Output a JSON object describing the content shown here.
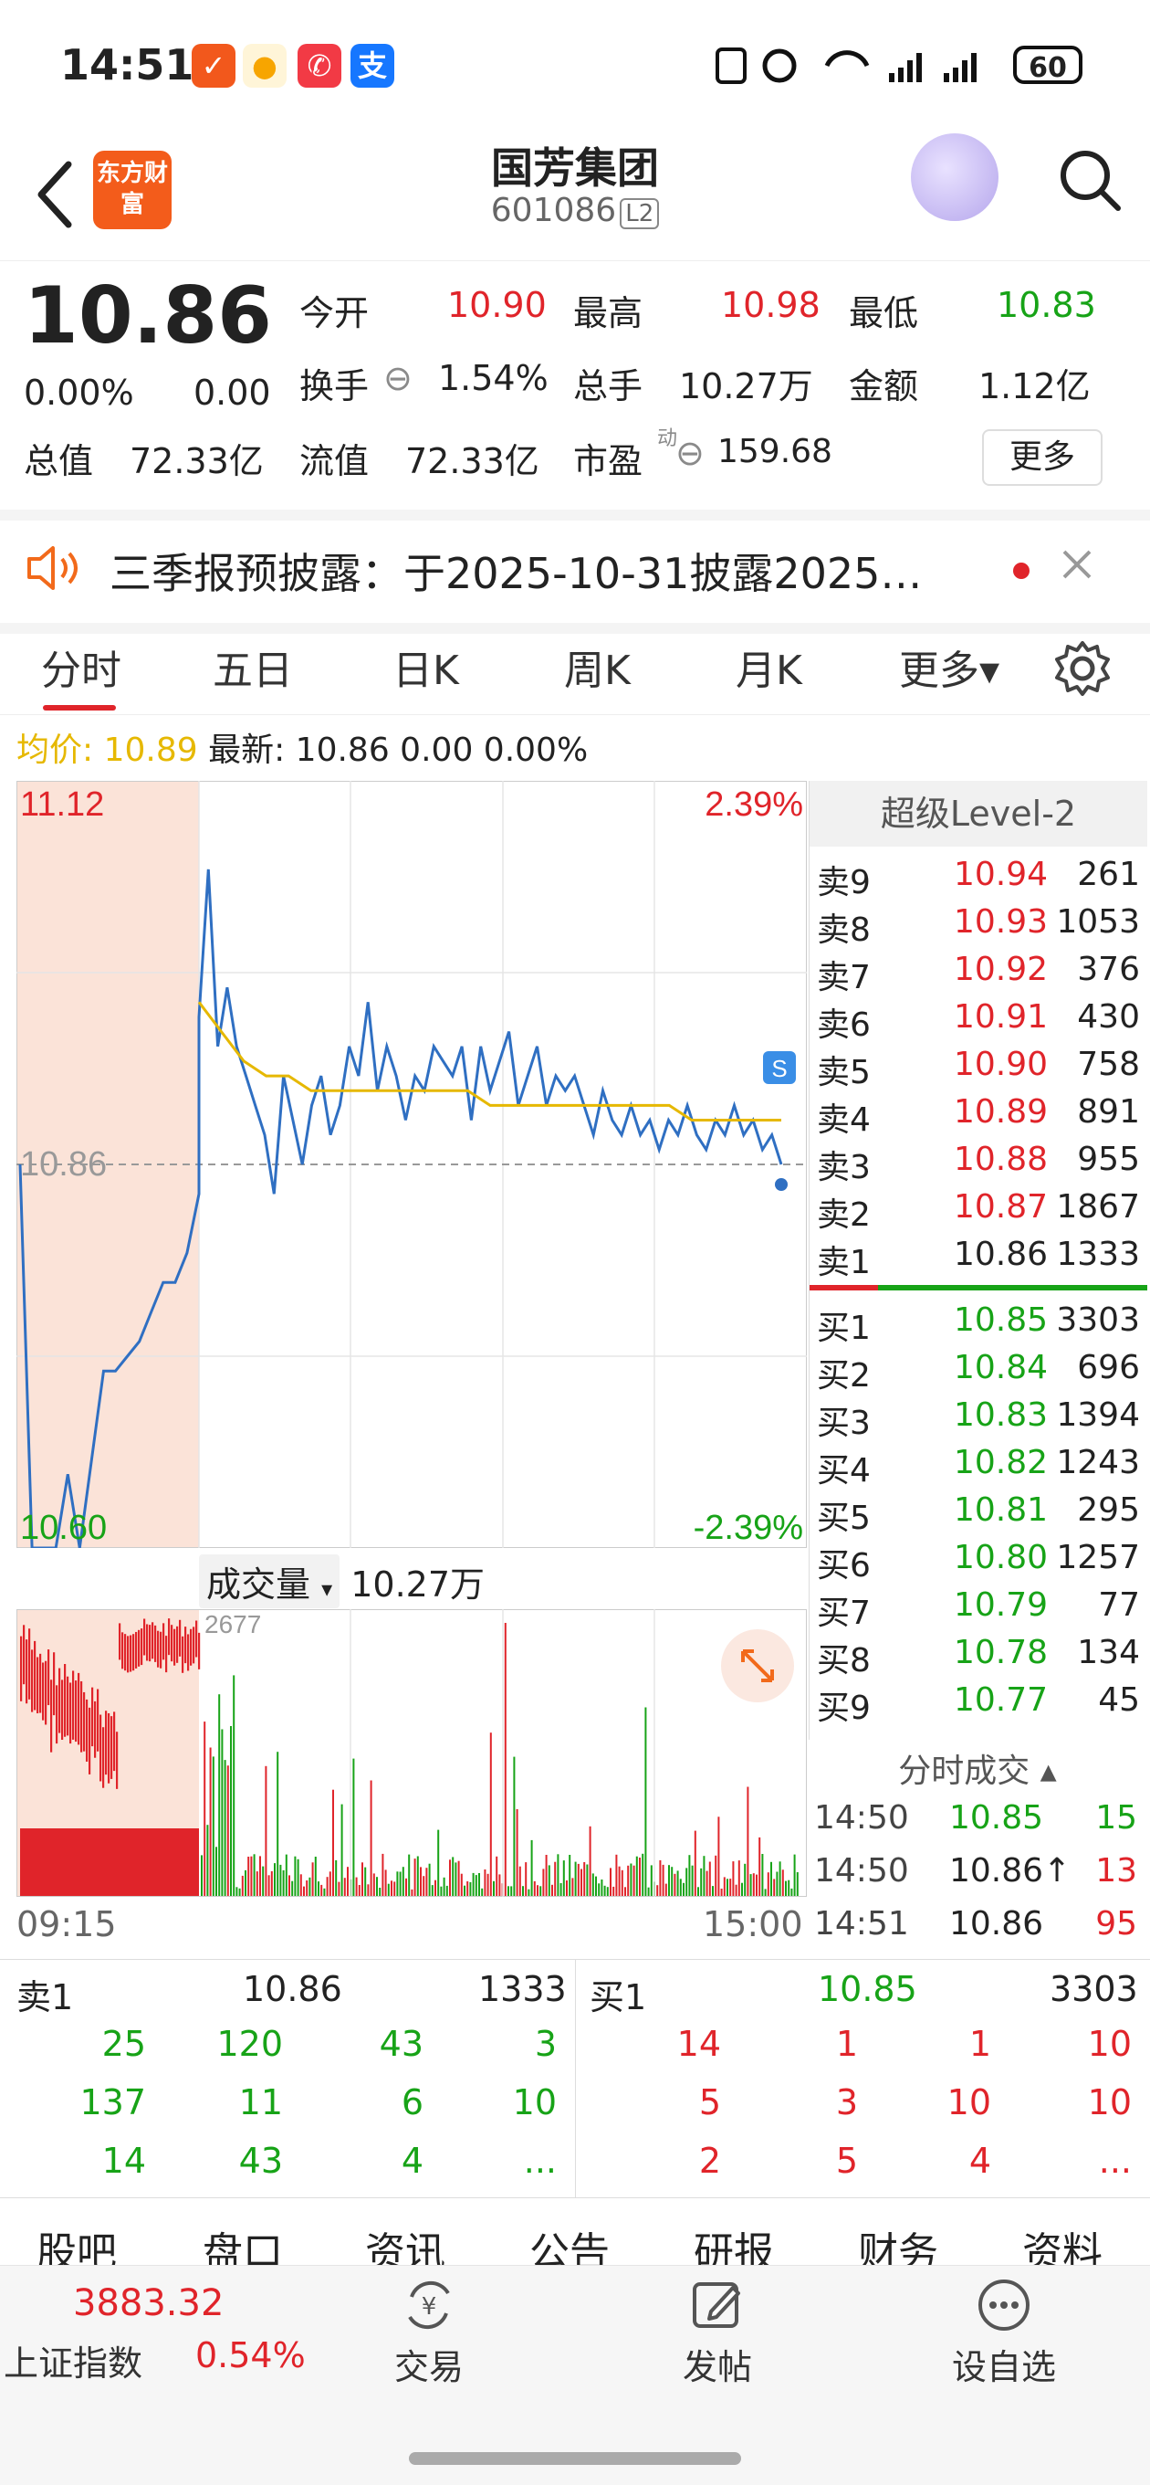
{
  "status_bar": {
    "time": "14:51",
    "battery": "60"
  },
  "header": {
    "back": "back",
    "logo_text": "东方财富",
    "stock_name": "国芳集团",
    "stock_code": "601086",
    "badge": "L2"
  },
  "quote": {
    "price": "10.86",
    "change_pct": "0.00%",
    "change": "0.00",
    "open_label": "今开",
    "open": "10.90",
    "high_label": "最高",
    "high": "10.98",
    "low_label": "最低",
    "low": "10.83",
    "turnover_label": "换手",
    "turnover": "1.54%",
    "volume_label": "总手",
    "volume": "10.27万",
    "amount_label": "金额",
    "amount": "1.12亿",
    "mktcap_label": "总值",
    "mktcap": "72.33亿",
    "float_label": "流值",
    "float": "72.33亿",
    "pe_label": "市盈",
    "pe_sup": "动",
    "pe": "159.68",
    "more": "更多"
  },
  "notice": {
    "text": "三季报预披露：于2025-10-31披露2025…"
  },
  "tabs": [
    "分时",
    "五日",
    "日K",
    "周K",
    "月K",
    "更多▾"
  ],
  "avg_line": {
    "label": "均价:",
    "avg": "10.89",
    "latest": "最新: 10.86 0.00 0.00%"
  },
  "chart_labels": {
    "top_price": "11.12",
    "top_pct": "2.39%",
    "mid_price": "10.86",
    "bottom_price": "10.60",
    "bottom_pct": "-2.39%",
    "vol_max": "2677",
    "time_start": "09:15",
    "time_end": "15:00",
    "vol_label": "成交量",
    "vol_value": "10.27万"
  },
  "chart_data": {
    "type": "line",
    "ylim": [
      10.6,
      11.12
    ],
    "series": [
      {
        "values": [
          10.86,
          10.6,
          10.6,
          10.6,
          10.65,
          10.6,
          10.66,
          10.72,
          10.72,
          10.73,
          10.74,
          10.76,
          10.78,
          10.78,
          10.8,
          10.84,
          10.96,
          11.06,
          10.94,
          10.98,
          10.94,
          10.92,
          10.9,
          10.88,
          10.84,
          10.92,
          10.89,
          10.86,
          10.9,
          10.92,
          10.88,
          10.9,
          10.94,
          10.92,
          10.97,
          10.91,
          10.94,
          10.92,
          10.89,
          10.92,
          10.91,
          10.94,
          10.93,
          10.92,
          10.94,
          10.89,
          10.94,
          10.91,
          10.93,
          10.95,
          10.9,
          10.92,
          10.94,
          10.9,
          10.92,
          10.91,
          10.92,
          10.9,
          10.88,
          10.91,
          10.89,
          10.88,
          10.9,
          10.88,
          10.89,
          10.87,
          10.89,
          10.88,
          10.9,
          10.88,
          10.87,
          10.89,
          10.88,
          10.9,
          10.88,
          10.89,
          10.87,
          10.88,
          10.86
        ]
      },
      {
        "values": [
          10.97,
          10.95,
          10.93,
          10.92,
          10.92,
          10.91,
          10.91,
          10.91,
          10.91,
          10.91,
          10.91,
          10.91,
          10.91,
          10.9,
          10.9,
          10.9,
          10.9,
          10.9,
          10.9,
          10.9,
          10.9,
          10.9,
          10.89,
          10.89,
          10.89,
          10.89,
          10.89
        ]
      }
    ]
  },
  "order_book": {
    "title": "超级Level-2",
    "sells": [
      {
        "label": "卖9",
        "price": "10.94",
        "vol": "261"
      },
      {
        "label": "卖8",
        "price": "10.93",
        "vol": "1053"
      },
      {
        "label": "卖7",
        "price": "10.92",
        "vol": "376"
      },
      {
        "label": "卖6",
        "price": "10.91",
        "vol": "430"
      },
      {
        "label": "卖5",
        "price": "10.90",
        "vol": "758"
      },
      {
        "label": "卖4",
        "price": "10.89",
        "vol": "891"
      },
      {
        "label": "卖3",
        "price": "10.88",
        "vol": "955"
      },
      {
        "label": "卖2",
        "price": "10.87",
        "vol": "1867"
      },
      {
        "label": "卖1",
        "price": "10.86",
        "vol": "1333"
      }
    ],
    "buys": [
      {
        "label": "买1",
        "price": "10.85",
        "vol": "3303"
      },
      {
        "label": "买2",
        "price": "10.84",
        "vol": "696"
      },
      {
        "label": "买3",
        "price": "10.83",
        "vol": "1394"
      },
      {
        "label": "买4",
        "price": "10.82",
        "vol": "1243"
      },
      {
        "label": "买5",
        "price": "10.81",
        "vol": "295"
      },
      {
        "label": "买6",
        "price": "10.80",
        "vol": "1257"
      },
      {
        "label": "买7",
        "price": "10.79",
        "vol": "77"
      },
      {
        "label": "买8",
        "price": "10.78",
        "vol": "134"
      },
      {
        "label": "买9",
        "price": "10.77",
        "vol": "45"
      }
    ]
  },
  "ticks": {
    "title": "分时成交 ▴",
    "rows": [
      {
        "time": "14:50",
        "price": "10.85",
        "vol": "15"
      },
      {
        "time": "14:50",
        "price": "10.86↑",
        "vol": "13"
      },
      {
        "time": "14:51",
        "price": "10.86",
        "vol": "95"
      }
    ]
  },
  "queue": {
    "sell_label": "卖1",
    "sell_price": "10.86",
    "sell_total": "1333",
    "buy_label": "买1",
    "buy_price": "10.85",
    "buy_total": "3303",
    "sell_rows": [
      [
        "25",
        "120",
        "43",
        "3"
      ],
      [
        "137",
        "11",
        "6",
        "10"
      ],
      [
        "14",
        "43",
        "4",
        "..."
      ]
    ],
    "buy_rows": [
      [
        "14",
        "1",
        "1",
        "10"
      ],
      [
        "5",
        "3",
        "10",
        "10"
      ],
      [
        "2",
        "5",
        "4",
        "..."
      ]
    ]
  },
  "bottom_tabs": [
    "股吧",
    "盘口",
    "资讯",
    "公告",
    "研报",
    "财务",
    "资料"
  ],
  "footer": {
    "index_value": "3883.32",
    "index_name": "上证指数",
    "index_pct": "0.54%",
    "trade": "交易",
    "post": "发帖",
    "watch": "设自选"
  }
}
